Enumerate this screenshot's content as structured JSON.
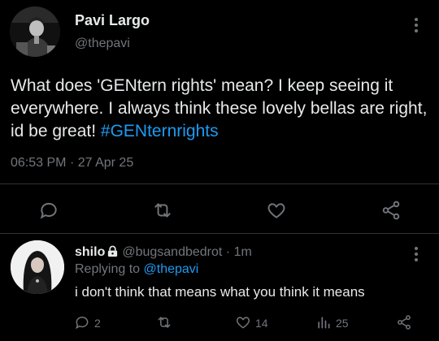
{
  "tweet": {
    "author_name": "Pavi Largo",
    "author_handle": "@thepavi",
    "text": "What does 'GENtern rights' mean? I keep seeing it everywhere. I always think these lovely bellas are right, id be great! ",
    "hashtag": "#GENternrights",
    "time": "06:53 PM",
    "separator": "·",
    "date": "27 Apr 25"
  },
  "reply": {
    "author_name": "shilo",
    "author_handle": "@bugsandbedrot",
    "separator": "·",
    "time_ago": "1m",
    "replying_to_label": "Replying to ",
    "replying_to_handle": "@thepavi",
    "text": "i don't think that means what you think it means",
    "counts": {
      "replies": "2",
      "likes": "14",
      "views": "25"
    }
  },
  "colors": {
    "background": "#000000",
    "text": "#e7e9ea",
    "muted": "#71767b",
    "accent": "#1d9bf0",
    "divider": "#2f3336"
  },
  "icons": {
    "reply": "reply-icon",
    "retweet": "retweet-icon",
    "like": "like-icon",
    "share": "share-icon",
    "views": "views-icon",
    "lock": "lock-icon",
    "more": "more-icon"
  }
}
